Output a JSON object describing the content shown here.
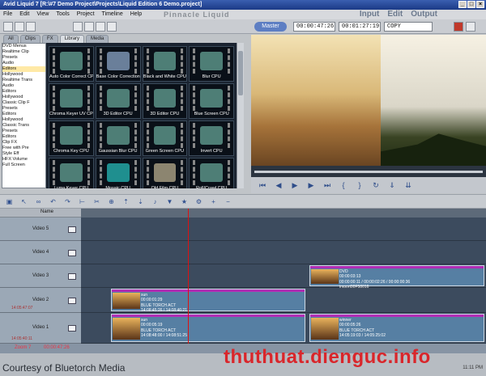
{
  "window": {
    "title": "Avid Liquid 7 [R:\\#7 Demo Project\\Projects\\Liquid Edition 6 Demo.project]"
  },
  "menu": [
    "File",
    "Edit",
    "View",
    "Tools",
    "Project",
    "Timeline",
    "Help"
  ],
  "brand": "Pinnacle Liquid",
  "modes": [
    "Input",
    "Edit",
    "Output"
  ],
  "toolbar": {
    "master_label": "Master",
    "timecode_in": "00:00:47:26",
    "timecode_out": "00:01:27:19",
    "copy_label": "COPY"
  },
  "library": {
    "tabs": [
      "All",
      "Clips",
      "FX",
      "Library",
      "Media"
    ],
    "active_tab": "Library",
    "tree": [
      "DVD Menus",
      "Realtime Clip",
      "Presets",
      "Audio",
      "Editors",
      "Hollywood",
      "Realtime Trans",
      "Audio",
      "Editors",
      "Hollywood",
      "Classic Clip F",
      "Presets",
      "Editors",
      "Hollywood",
      "Classic Trans",
      "Presets",
      "Editors",
      "Clip FX",
      "Free with Pre",
      "Style Eff",
      "HFX Volume",
      "Full Screen"
    ],
    "selected_node": 4,
    "items": [
      {
        "label": "Auto Color Correct CPU",
        "icon": "film-effect-icon",
        "color": "#4e7e76"
      },
      {
        "label": "Base Color Correction",
        "icon": "color-wheel-icon",
        "color": "#6a7f9a"
      },
      {
        "label": "Black and White CPU",
        "icon": "film-effect-icon",
        "color": "#4e7e76"
      },
      {
        "label": "Blur CPU",
        "icon": "film-effect-icon",
        "color": "#4e7e76"
      },
      {
        "label": "Chroma Keyer UV CPU",
        "icon": "film-effect-icon",
        "color": "#4e7e76"
      },
      {
        "label": "3D Editor CPU",
        "icon": "rotate-icon",
        "color": "#4e7e76"
      },
      {
        "label": "3D Editor CPU",
        "icon": "rotate-icon",
        "color": "#4e7e76"
      },
      {
        "label": "Blue Screen CPU",
        "icon": "film-effect-icon",
        "color": "#4e7e76"
      },
      {
        "label": "Chroma Key CPU",
        "icon": "film-effect-icon",
        "color": "#4e7e76"
      },
      {
        "label": "Gaussian Blur CPU",
        "icon": "film-effect-icon",
        "color": "#4e7e76"
      },
      {
        "label": "Green Screen CPU",
        "icon": "film-effect-icon",
        "color": "#4e7e76"
      },
      {
        "label": "Invert CPU",
        "icon": "film-effect-icon",
        "color": "#4e7e76"
      },
      {
        "label": "Luma Keyer CPU",
        "icon": "film-effect-icon",
        "color": "#4e7e76"
      },
      {
        "label": "Mosaic CPU",
        "icon": "mosaic-icon",
        "color": "#1f8f8f"
      },
      {
        "label": "Old Film CPU",
        "icon": "old-film-icon",
        "color": "#8c8570"
      },
      {
        "label": "Roll/Crawl CPU",
        "icon": "arrow-up-icon",
        "color": "#4e7e76"
      }
    ]
  },
  "timeline": {
    "name_header": "Name",
    "zoom_label": "Zoom 7",
    "zoom_timecode": "00:00:47:26",
    "tracks": [
      {
        "name": "Video 5",
        "sub": "",
        "clips": []
      },
      {
        "name": "Video 4",
        "sub": "",
        "clips": []
      },
      {
        "name": "Video 3",
        "sub": "",
        "clips": [
          {
            "id": "dvd",
            "title": "DVD",
            "info": "00:00:03:13\n00:00:00:11 / 00:00:02:26 / 00:00:00:36\nimport00F58016"
          }
        ]
      },
      {
        "name": "Video 2",
        "sub": "14:05:47:07",
        "clips": [
          {
            "id": "sun",
            "title": "sun",
            "info": "00:00:01:29\nBLUE TORCH ACT\n14:08:45:26 / 14:08:46:21"
          }
        ]
      },
      {
        "name": "Video 1",
        "sub": "14:05:40:11",
        "clips": [
          {
            "id": "sun2",
            "title": "sun",
            "info": "00:00:05:19\nBLUE TORCH ACT\n14:08:48:00 / 14:08:51:25"
          },
          {
            "id": "winner",
            "title": "winner",
            "info": "00:00:05:26\nBLUE TORCH ACT\n14:05:19:03 / 14:05:25:02"
          }
        ]
      }
    ]
  },
  "footer": {
    "courtesy": "Courtesy of Bluetorch Media",
    "watermark": "thuthuat.dienguc.info",
    "clock": "11:11 PM"
  }
}
